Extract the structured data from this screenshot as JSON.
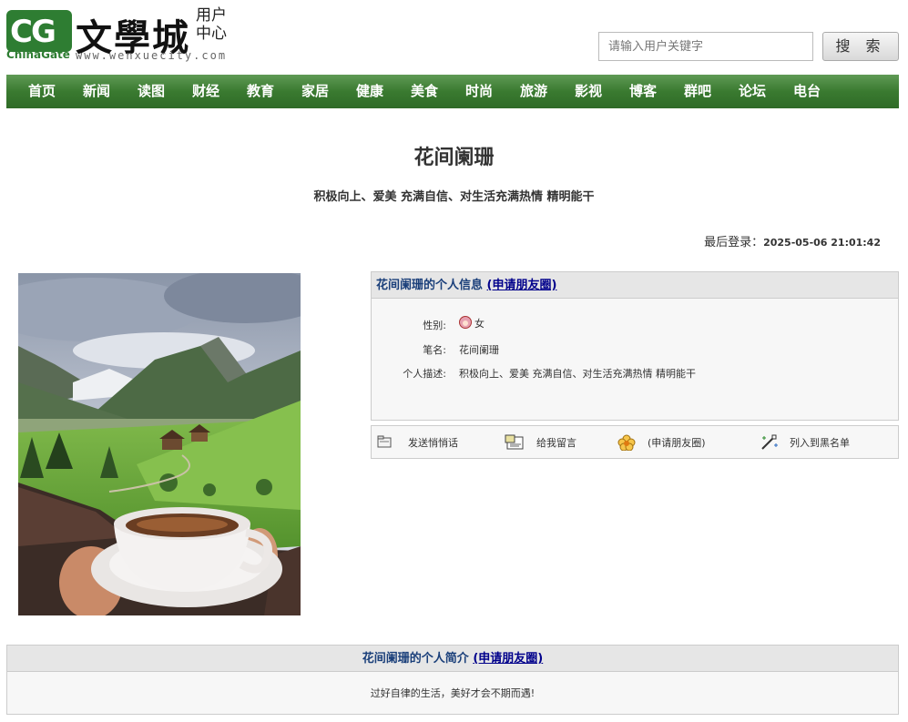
{
  "header": {
    "logo_cg": "CG",
    "logo_chinagate": "ChinaGate",
    "logo_brand": "文學城",
    "logo_url": "www.wenxuecity.com",
    "user_center_line1": "用户",
    "user_center_line2": "中心",
    "search_placeholder": "请输入用户关键字",
    "search_button": "搜 索"
  },
  "nav": {
    "items": [
      "首页",
      "新闻",
      "读图",
      "财经",
      "教育",
      "家居",
      "健康",
      "美食",
      "时尚",
      "旅游",
      "影视",
      "博客",
      "群吧",
      "论坛",
      "电台"
    ]
  },
  "profile": {
    "title": "花间阑珊",
    "subtitle": "积极向上、爱美 充满自信、对生活充满热情 精明能干",
    "last_login_label": "最后登录：",
    "last_login_value": "2025-05-06 21:01:42"
  },
  "info": {
    "heading": "花间阑珊的个人信息",
    "heading_link": "(申请朋友圈)",
    "gender_label": "性别:",
    "gender_value": "女",
    "penname_label": "笔名:",
    "penname_value": "花间阑珊",
    "desc_label": "个人描述:",
    "desc_value": "积极向上、爱美 充满自信、对生活充满热情 精明能干"
  },
  "actions": {
    "send_message": "发送悄悄话",
    "leave_message": "给我留言",
    "apply_friends": "(申请朋友圈)",
    "blacklist": "列入到黑名单"
  },
  "bio": {
    "heading": "花间阑珊的个人简介",
    "heading_link": "(申请朋友圈)",
    "text": "过好自律的生活，美好才会不期而遇!"
  },
  "colors": {
    "nav_green": "#3a7a30",
    "link_blue": "#00008b",
    "heading_blue": "#1a3f7a"
  }
}
